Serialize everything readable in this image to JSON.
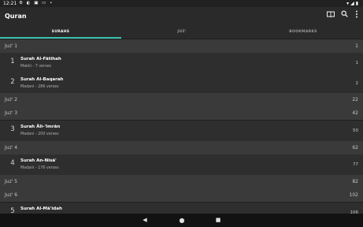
{
  "status": {
    "time": "12:21",
    "left_icons": "⚙ ◐ ▣ ▭ •",
    "right_icons": "▾◢▮"
  },
  "app": {
    "title": "Quran"
  },
  "toolbar": {
    "bookmarks_icon": "book-icon",
    "search_icon": "search-icon",
    "more_icon": "more-vert-icon"
  },
  "tabs": [
    {
      "label": "SURAHS",
      "active": true
    },
    {
      "label": "JUZ'",
      "active": false
    },
    {
      "label": "BOOKMARKS",
      "active": false
    }
  ],
  "juz": [
    {
      "label": "Juz' 1",
      "page": "1"
    },
    {
      "label": "Juz' 2",
      "page": "22"
    },
    {
      "label": "Juz' 3",
      "page": "42"
    },
    {
      "label": "Juz' 4",
      "page": "62"
    },
    {
      "label": "Juz' 5",
      "page": "82"
    },
    {
      "label": "Juz' 6",
      "page": "102"
    }
  ],
  "surahs": [
    {
      "number": "1",
      "name": "Surah Al-Fātihah",
      "meta": "Makki - 7 verses",
      "page": "1"
    },
    {
      "number": "2",
      "name": "Surah Al-Baqarah",
      "meta": "Madani - 286 verses",
      "page": "2"
    },
    {
      "number": "3",
      "name": "Surah Āli-'Imrān",
      "meta": "Madani - 200 verses",
      "page": "50"
    },
    {
      "number": "4",
      "name": "Surah An-Nisā'",
      "meta": "Madani - 176 verses",
      "page": "77"
    },
    {
      "number": "5",
      "name": "Surah Al-Mā'idah",
      "meta": "",
      "page": "106"
    }
  ],
  "nav": {
    "back": "◀",
    "home": "●",
    "recents": "■"
  },
  "colors": {
    "accent": "#3ec4b1",
    "juz_bg": "#3a3a3a",
    "surah_bg": "#2e2e2e"
  }
}
